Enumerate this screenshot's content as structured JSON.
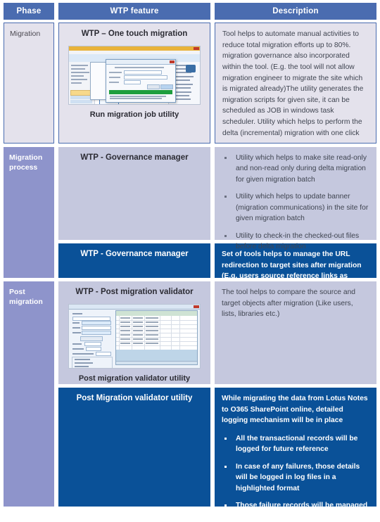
{
  "header": {
    "col_phase": "Phase",
    "col_feature": "WTP feature",
    "col_description": "Description"
  },
  "colors": {
    "header_blue": "#4A6CB0",
    "dark_blue": "#0A5198",
    "phase_purple": "#8E94CB",
    "cell_light": "#E4E2EC",
    "cell_grayblue": "#C5C8DE"
  },
  "rows": [
    {
      "phase": "Migration",
      "feature_title": "WTP – One touch migration",
      "feature_caption": "Run migration job utility",
      "description": "Tool helps to automate manual activities to reduce total migration efforts up to 80%. migration governance also incorporated within the tool. (E.g. the tool will not allow migration engineer to migrate the site which is migrated already)The utility generates the migration scripts for given site, it can be scheduled as JOB in windows task scheduler. Utility which helps to perform the delta (incremental) migration with one click"
    },
    {
      "phase": "Migration process",
      "sub_light": {
        "feature_title": "WTP - Governance manager",
        "bullets": [
          "Utility which helps to make site read-only and non-read only during delta migration for given migration batch",
          "Utility which helps to update banner (migration communications) in the site for given migration batch",
          "Utility to check-in the checked-out files before delta migration"
        ]
      },
      "sub_dark": {
        "feature_title": "WTP - Governance manager",
        "description": "Set of tools helps to manage the URL redirection to target sites after migration (E.g. users source reference links as favorites in IE)"
      }
    },
    {
      "phase": "Post migration",
      "sub_light": {
        "feature_title": "WTP - Post migration validator",
        "feature_caption": "Post migration validator utility",
        "description": "The tool helps to compare the source and target objects after migration (Like users, lists, libraries etc.)"
      },
      "sub_dark": {
        "feature_title": "Post Migration validator utility",
        "intro": "While migrating the data from Lotus Notes to O365 SharePoint online, detailed logging mechanism will be in place",
        "bullets": [
          "All the transactional records will be logged for future reference",
          "In case of any failures, those details will be logged in log files in a highlighted format",
          "Those failure records will be managed separately"
        ]
      }
    }
  ]
}
